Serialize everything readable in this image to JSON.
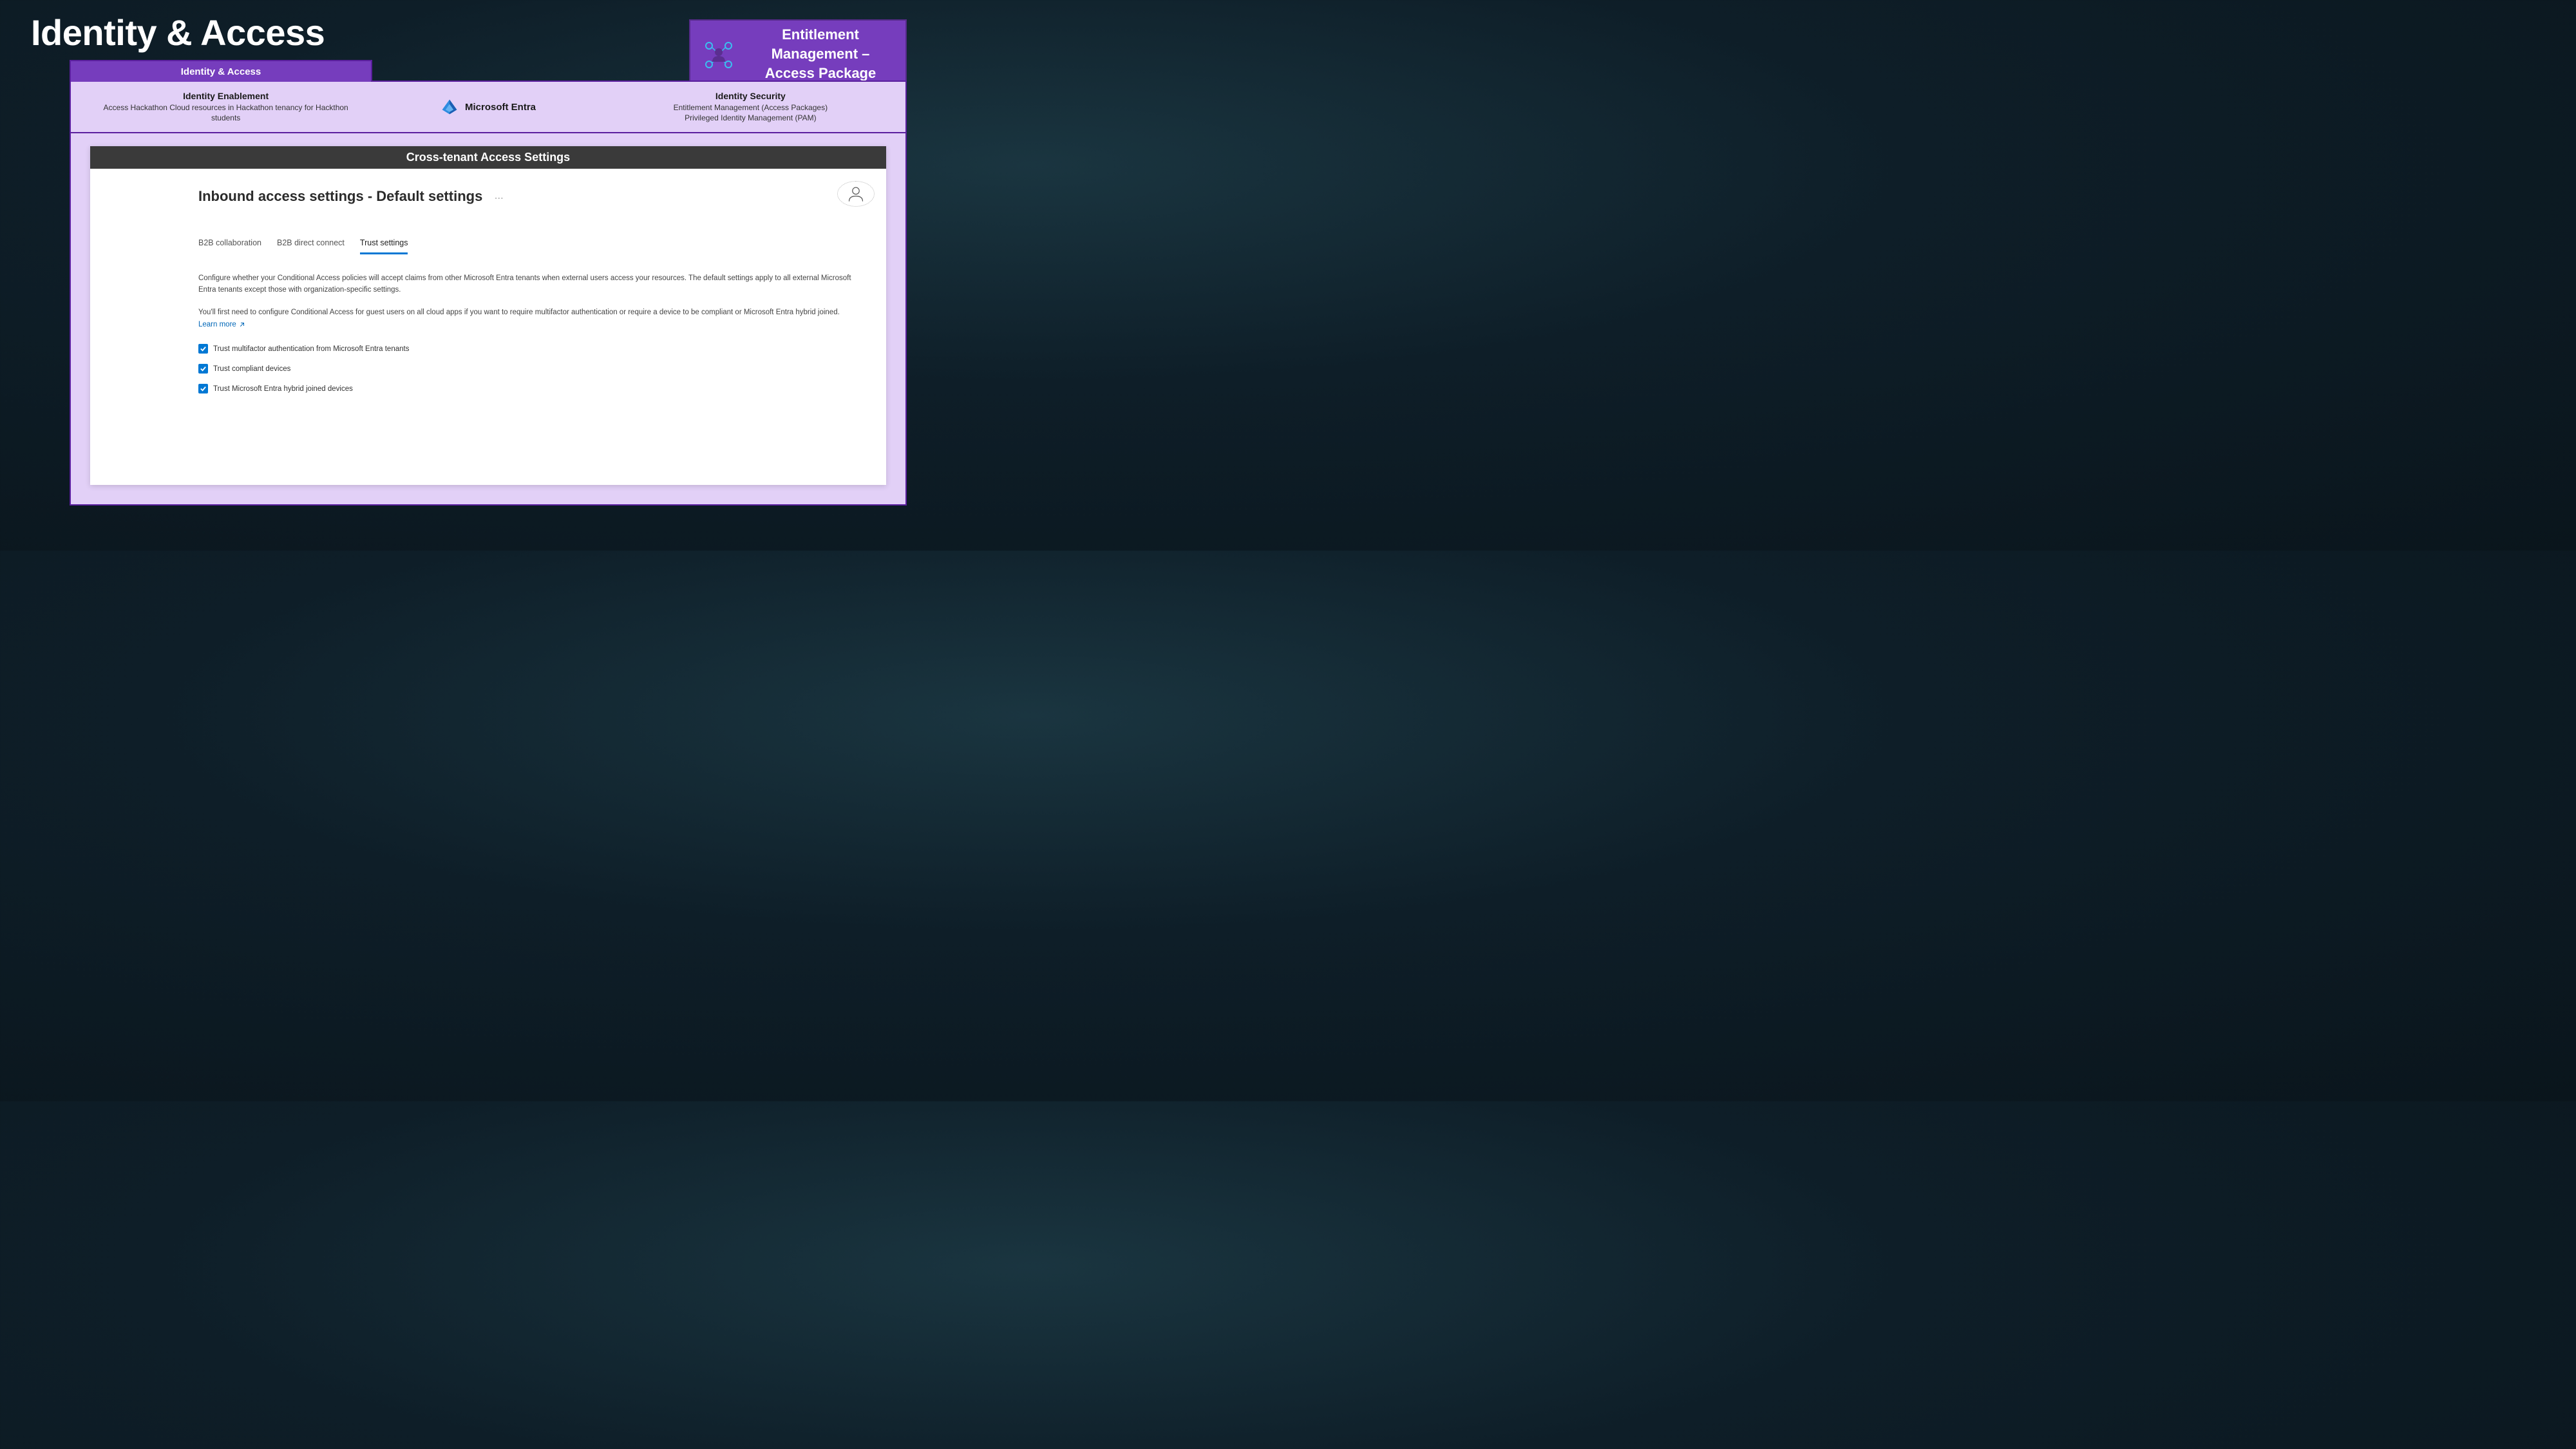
{
  "slide": {
    "title": "Identity & Access"
  },
  "badge": {
    "line1": "Entitlement",
    "line2": "Management –",
    "line3": "Access Package"
  },
  "tab": {
    "label": "Identity & Access"
  },
  "info": {
    "left": {
      "title": "Identity Enablement",
      "sub": "Access Hackathon Cloud resources in Hackathon tenancy for Hackthon students"
    },
    "center": {
      "product": "Microsoft Entra"
    },
    "right": {
      "title": "Identity Security",
      "sub1": "Entitlement Management (Access Packages)",
      "sub2": "Privileged Identity Management (PAM)"
    }
  },
  "section": {
    "title": "Cross-tenant Access Settings"
  },
  "page": {
    "heading": "Inbound access settings - Default settings",
    "tabs": {
      "b2bCollab": "B2B collaboration",
      "b2bDirect": "B2B direct connect",
      "trust": "Trust settings"
    },
    "desc1": "Configure whether your Conditional Access policies will accept claims from other Microsoft Entra tenants when external users access your resources. The default settings apply to all external Microsoft Entra tenants except those with organization-specific settings.",
    "desc2": "You'll first need to configure Conditional Access for guest users on all cloud apps if you want to require multifactor authentication or require a device to be compliant or Microsoft Entra hybrid joined.",
    "learnMore": "Learn more",
    "checks": {
      "mfa": "Trust multifactor authentication from Microsoft Entra tenants",
      "compliant": "Trust compliant devices",
      "hybrid": "Trust Microsoft Entra hybrid joined devices"
    }
  }
}
